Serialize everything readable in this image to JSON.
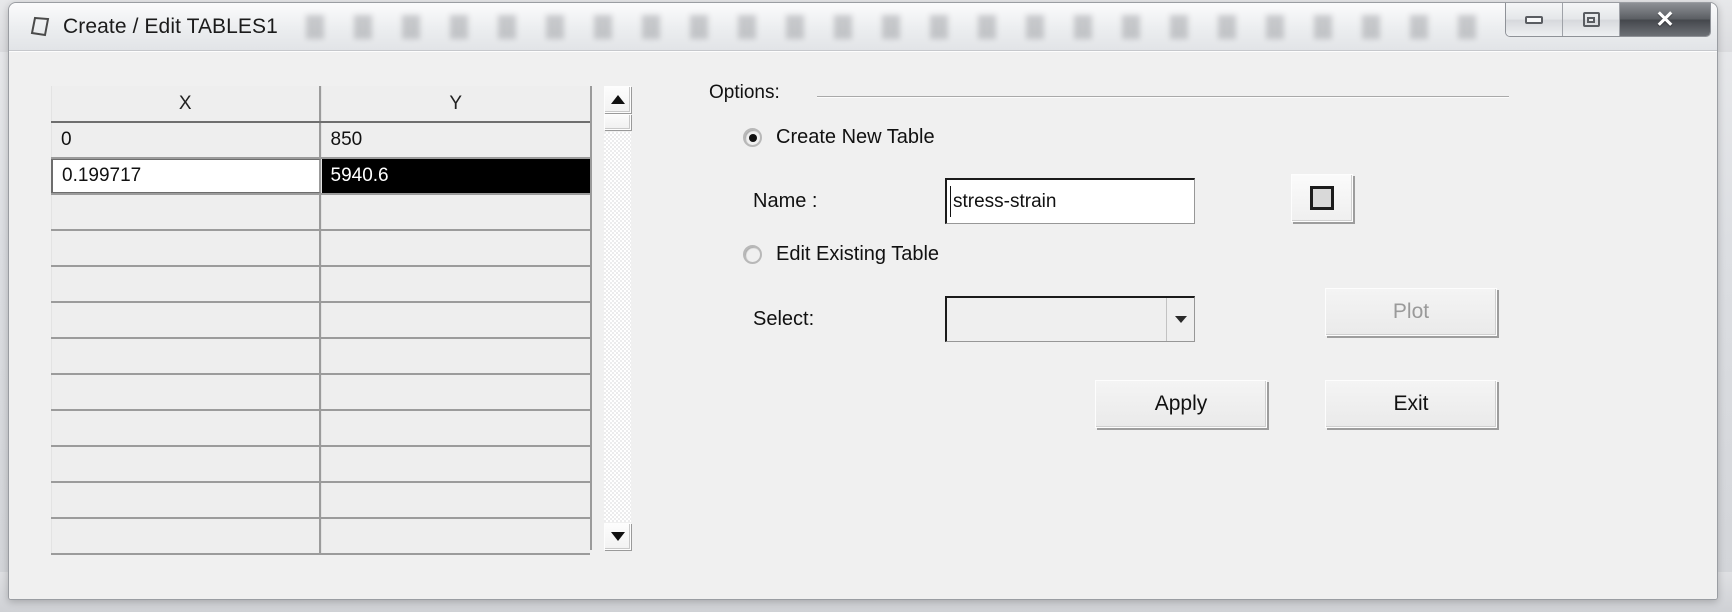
{
  "window": {
    "title": "Create / Edit TABLES1",
    "icon": "table-quad-icon",
    "controls": {
      "minimize": "minimize-icon",
      "restore": "restore-icon",
      "close": "close-icon"
    }
  },
  "grid": {
    "columns": [
      "X",
      "Y"
    ],
    "rows": [
      {
        "x": "0",
        "y": "850",
        "state": "filled"
      },
      {
        "x": "0.199717",
        "y": "5940.6",
        "state": "editing"
      },
      {
        "x": "",
        "y": "",
        "state": "empty"
      },
      {
        "x": "",
        "y": "",
        "state": "empty"
      },
      {
        "x": "",
        "y": "",
        "state": "empty"
      },
      {
        "x": "",
        "y": "",
        "state": "empty"
      },
      {
        "x": "",
        "y": "",
        "state": "empty"
      },
      {
        "x": "",
        "y": "",
        "state": "empty"
      },
      {
        "x": "",
        "y": "",
        "state": "empty"
      },
      {
        "x": "",
        "y": "",
        "state": "empty"
      },
      {
        "x": "",
        "y": "",
        "state": "empty"
      },
      {
        "x": "",
        "y": "",
        "state": "empty"
      }
    ],
    "scrollbar": {
      "up": "scroll-up-arrow-icon",
      "down": "scroll-down-arrow-icon"
    }
  },
  "options": {
    "legend": "Options:",
    "create_new_table": {
      "label": "Create New Table",
      "selected": true
    },
    "name": {
      "label": "Name :",
      "value": "stress-strain",
      "placeholder": ""
    },
    "swatch_button": "preview-square-icon",
    "edit_existing_table": {
      "label": "Edit Existing Table",
      "selected": false
    },
    "select": {
      "label": "Select:",
      "value": "",
      "options": []
    },
    "buttons": {
      "plot": "Plot",
      "apply": "Apply",
      "exit": "Exit"
    }
  },
  "colors": {
    "dialog_face": "#f0f0f0",
    "grid_cell": "#eeeeee",
    "selection": "#000000",
    "grid_line": "#9b9b9b",
    "disabled_text": "#9a9a9a"
  }
}
